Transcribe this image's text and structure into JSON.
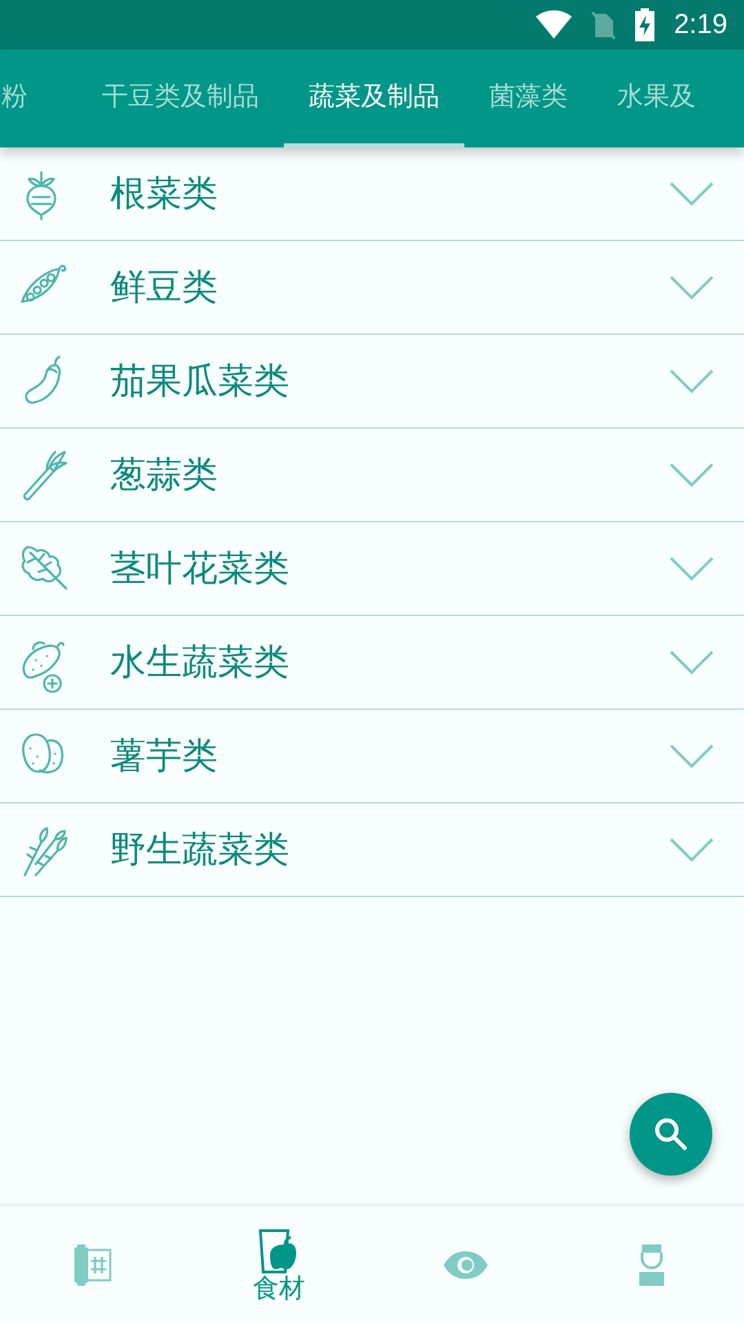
{
  "status_bar": {
    "time": "2:19"
  },
  "tabs": [
    {
      "label": "粉",
      "selected": false
    },
    {
      "label": "干豆类及制品",
      "selected": false
    },
    {
      "label": "蔬菜及制品",
      "selected": true
    },
    {
      "label": "菌藻类",
      "selected": false
    },
    {
      "label": "水果及",
      "selected": false
    }
  ],
  "categories": [
    {
      "name": "根菜类",
      "expanded": false
    },
    {
      "name": "鲜豆类",
      "expanded": false
    },
    {
      "name": "茄果瓜菜类",
      "expanded": false
    },
    {
      "name": "葱蒜类",
      "expanded": false
    },
    {
      "name": "茎叶花菜类",
      "expanded": false
    },
    {
      "name": "水生蔬菜类",
      "expanded": false
    },
    {
      "name": "薯芋类",
      "expanded": false
    },
    {
      "name": "野生蔬菜类",
      "expanded": false
    }
  ],
  "bottom_nav": [
    {
      "selected": false
    },
    {
      "selected": true,
      "label": "食材"
    },
    {
      "selected": false
    },
    {
      "selected": false
    }
  ]
}
